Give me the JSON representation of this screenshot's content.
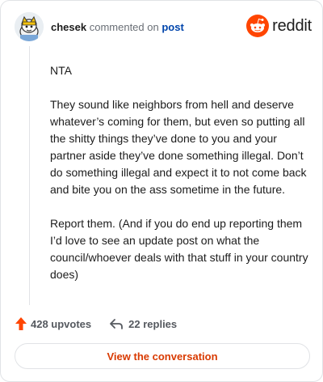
{
  "comment": {
    "author": "chesek",
    "action_text": "commented on",
    "post_link_label": "post",
    "paragraphs": [
      "NTA",
      "They sound like neighbors from hell and deserve whatever’s coming for them, but even so putting all the shitty things they’ve done to you and your partner aside they’ve done something illegal. Don’t do something illegal and expect it to not come back and bite you on the ass sometime in the future.",
      "Report them. (And if you do end up reporting them I’d love to see an update post on what the council/whoever deals with that stuff in your country does)"
    ]
  },
  "brand": {
    "wordmark": "reddit",
    "logo_icon": "reddit-snoo-icon",
    "color": "#ff4500"
  },
  "stats": {
    "upvotes_label": "428 upvotes",
    "replies_label": "22 replies",
    "upvote_icon": "upvote-arrow-icon",
    "reply_icon": "reply-arrow-icon",
    "upvote_color": "#ff4500"
  },
  "cta": {
    "label": "View the conversation",
    "color": "#d93a00"
  },
  "avatar": {
    "icon": "avatar-icon"
  }
}
